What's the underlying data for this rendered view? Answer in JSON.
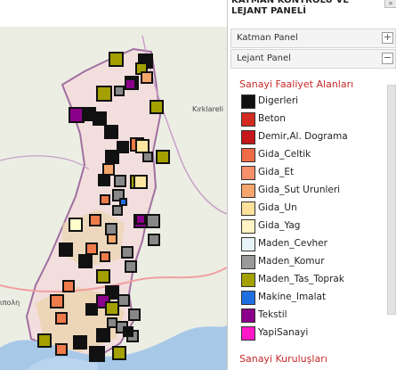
{
  "map": {
    "place_labels": [
      "Kırklareli",
      "ιπολη"
    ],
    "markers": [
      {
        "color": "#a3a000"
      },
      {
        "color": "#111111"
      },
      {
        "color": "#a3a000"
      },
      {
        "color": "#f4a56a"
      },
      {
        "color": "#111111"
      },
      {
        "color": "#8b008b"
      },
      {
        "color": "#a3a000"
      },
      {
        "color": "#888888"
      },
      {
        "color": "#8b008b"
      },
      {
        "color": "#111111"
      },
      {
        "color": "#111111"
      },
      {
        "color": "#a3a000"
      },
      {
        "color": "#111111"
      },
      {
        "color": "#ef7b4a"
      },
      {
        "color": "#ffe7a0"
      },
      {
        "color": "#111111"
      },
      {
        "color": "#a3a000"
      },
      {
        "color": "#888888"
      },
      {
        "color": "#111111"
      },
      {
        "color": "#f4a56a"
      },
      {
        "color": "#111111"
      },
      {
        "color": "#a3a000"
      },
      {
        "color": "#888888"
      },
      {
        "color": "#ffe7a0"
      },
      {
        "color": "#888888"
      },
      {
        "color": "#ef7b4a"
      },
      {
        "color": "#888888"
      },
      {
        "color": "#ffffcc"
      },
      {
        "color": "#888888"
      },
      {
        "color": "#8b008b"
      },
      {
        "color": "#ef7b4a"
      },
      {
        "color": "#888888"
      },
      {
        "color": "#f4a56a"
      },
      {
        "color": "#888888"
      },
      {
        "color": "#111111"
      },
      {
        "color": "#ef7b4a"
      },
      {
        "color": "#888888"
      },
      {
        "color": "#ef7b4a"
      },
      {
        "color": "#111111"
      },
      {
        "color": "#888888"
      },
      {
        "color": "#a3a000"
      },
      {
        "color": "#ef7b4a"
      },
      {
        "color": "#111111"
      },
      {
        "color": "#888888"
      },
      {
        "color": "#ef7b4a"
      },
      {
        "color": "#8b008b"
      },
      {
        "color": "#111111"
      },
      {
        "color": "#a3a000"
      },
      {
        "color": "#888888"
      },
      {
        "color": "#ef7b4a"
      },
      {
        "color": "#888888"
      },
      {
        "color": "#111111"
      },
      {
        "color": "#a3a000"
      },
      {
        "color": "#111111"
      },
      {
        "color": "#888888"
      },
      {
        "color": "#ef7b4a"
      },
      {
        "color": "#111111"
      },
      {
        "color": "#a3a000"
      },
      {
        "color": "#111111"
      },
      {
        "color": "#888888"
      },
      {
        "color": "#1e6fe0"
      },
      {
        "color": "#8b008b"
      }
    ]
  },
  "panel": {
    "title": "KATMAN KONTROLÜ VE LEJANT PANELİ",
    "collapse_glyph": "»",
    "katman_header": {
      "label": "Katman Panel",
      "button": "+"
    },
    "lejant_header": {
      "label": "Lejant Panel",
      "button": "−"
    },
    "legend": {
      "section_title": "Sanayi Faaliyet Alanları",
      "items": [
        {
          "label": "Digerleri",
          "color": "#111111"
        },
        {
          "label": "Beton",
          "color": "#d42b20"
        },
        {
          "label": "Demir,Al. Dograma",
          "color": "#c4161c"
        },
        {
          "label": "Gida_Celtik",
          "color": "#ef6b45"
        },
        {
          "label": "Gida_Et",
          "color": "#f4906a"
        },
        {
          "label": "Gida_Sut Urunleri",
          "color": "#f6a56c"
        },
        {
          "label": "Gida_Un",
          "color": "#ffe19a"
        },
        {
          "label": "Gida_Yag",
          "color": "#fff5c4"
        },
        {
          "label": "Maden_Cevher",
          "color": "#e6f4f8"
        },
        {
          "label": "Maden_Komur",
          "color": "#9a9a9a"
        },
        {
          "label": "Maden_Tas_Toprak",
          "color": "#a3a000"
        },
        {
          "label": "Makine_Imalat",
          "color": "#1e6fe0"
        },
        {
          "label": "Tekstil",
          "color": "#8b008b"
        },
        {
          "label": "YapiSanayi",
          "color": "#ff18c8"
        }
      ],
      "next_section_title": "Sanayi Kuruluşları"
    }
  }
}
